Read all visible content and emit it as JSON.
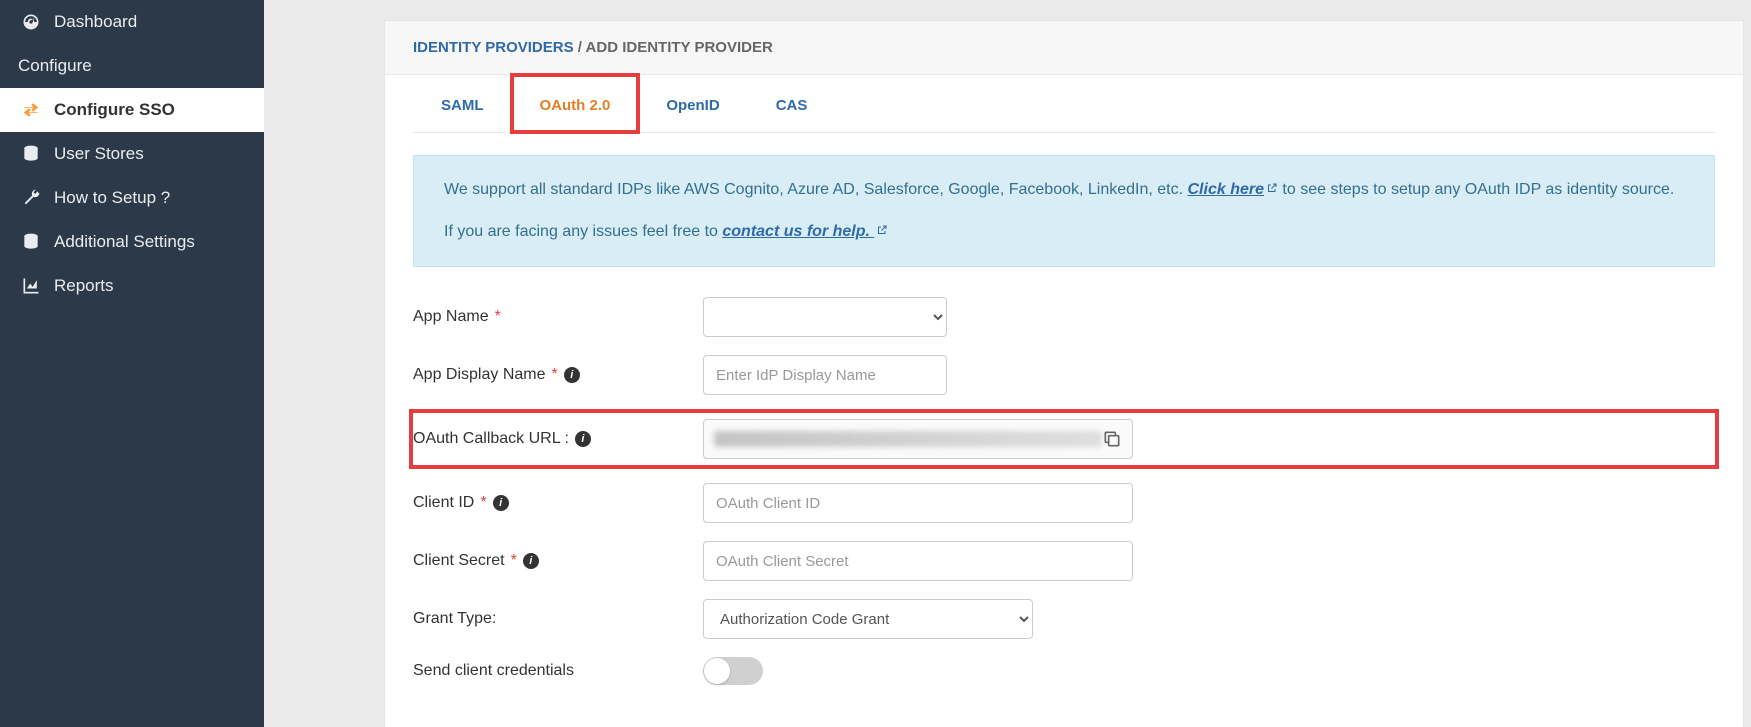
{
  "sidebar": {
    "dashboard": "Dashboard",
    "configure": "Configure",
    "configure_sso": "Configure SSO",
    "user_stores": "User Stores",
    "how_to_setup": "How to Setup ?",
    "additional_settings": "Additional Settings",
    "reports": "Reports"
  },
  "breadcrumb": {
    "parent": "IDENTITY PROVIDERS",
    "sep": " / ",
    "current": "ADD IDENTITY PROVIDER"
  },
  "tabs": {
    "saml": "SAML",
    "oauth": "OAuth 2.0",
    "openid": "OpenID",
    "cas": "CAS"
  },
  "info": {
    "line1_a": "We support all standard IDPs like AWS Cognito, Azure AD, Salesforce, Google, Facebook, LinkedIn, etc. ",
    "click_here": "Click here",
    "line1_b": " to see steps to setup any OAuth IDP as identity source.",
    "line2_a": "If you are facing any issues feel free to ",
    "contact_us": "contact us for help."
  },
  "form": {
    "app_name_label": "App Name",
    "app_name_value": "",
    "app_display_label": "App Display Name",
    "app_display_placeholder": "Enter IdP Display Name",
    "callback_label": "OAuth Callback URL :",
    "client_id_label": "Client ID",
    "client_id_placeholder": "OAuth Client ID",
    "client_secret_label": "Client Secret",
    "client_secret_placeholder": "OAuth Client Secret",
    "grant_type_label": "Grant Type:",
    "grant_type_value": "Authorization Code Grant",
    "send_creds_label": "Send client credentials"
  }
}
